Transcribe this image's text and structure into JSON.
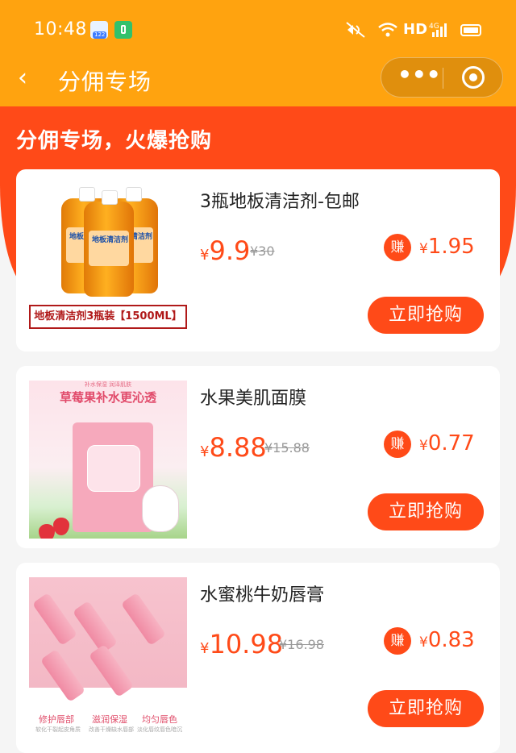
{
  "status_bar": {
    "time": "10:48",
    "network_label": "HD",
    "signal_label": "4G",
    "icons": [
      "app-notification-icon",
      "green-app-icon",
      "mute-icon",
      "wifi-icon",
      "signal-icon",
      "battery-icon"
    ]
  },
  "nav": {
    "back_icon": "‹",
    "title": "分佣专场",
    "more_icon": "•••",
    "close_icon": "target-icon"
  },
  "banner": {
    "text": "分佣专场，火爆抢购"
  },
  "products": [
    {
      "name": "3瓶地板清洁剂-包邮",
      "currency": "¥",
      "price": "9.9",
      "original_price": "¥30",
      "earn_badge": "赚",
      "earn_amount": "1.95",
      "buy_label": "立即抢购",
      "thumb_caption": "地板清洁剂3瓶装【1500ML】",
      "bottle_label": "地板清洁剂"
    },
    {
      "name": "水果美肌面膜",
      "currency": "¥",
      "price": "8.88",
      "original_price": "¥15.88",
      "earn_badge": "赚",
      "earn_amount": "0.77",
      "buy_label": "立即抢购",
      "thumb_headline": "草莓果补水更沁透",
      "thumb_subline": "补水保湿 润泽肌肤"
    },
    {
      "name": "水蜜桃牛奶唇膏",
      "currency": "¥",
      "price": "10.98",
      "original_price": "¥16.98",
      "earn_badge": "赚",
      "earn_amount": "0.83",
      "buy_label": "立即抢购",
      "features": [
        "修护唇部",
        "滋润保湿",
        "均匀唇色"
      ],
      "feature_notes": [
        "软化干裂起皮角质",
        "改善干燥缺水唇部",
        "淡化唇纹唇色暗沉"
      ]
    }
  ],
  "colors": {
    "title_bar": "#ffa30f",
    "accent": "#ff4a18",
    "page_bg": "#f5f5f5"
  }
}
